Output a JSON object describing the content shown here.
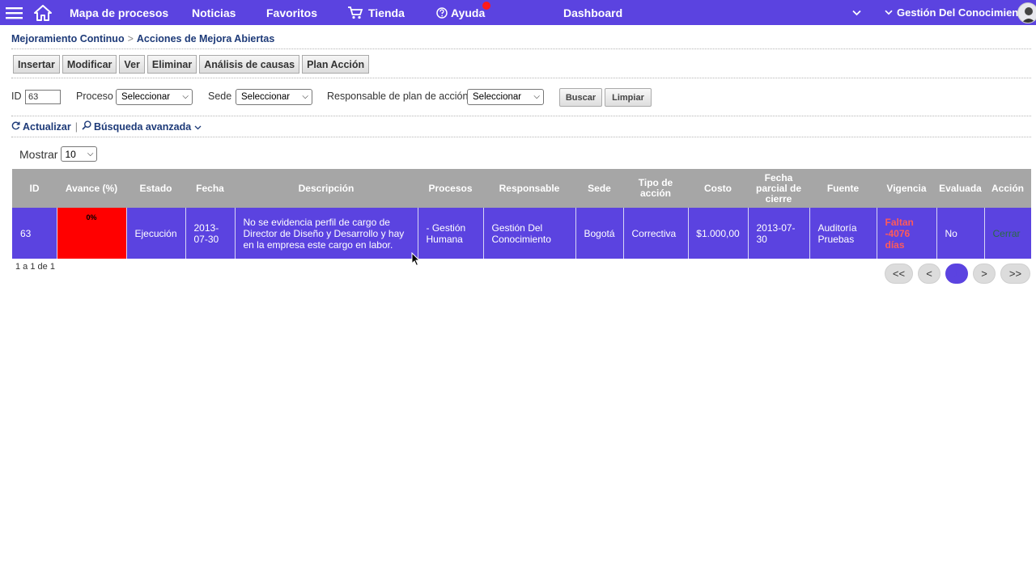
{
  "nav": {
    "items": [
      "Mapa de procesos",
      "Noticias",
      "Favoritos",
      "Tienda",
      "Ayuda",
      "Dashboard"
    ],
    "user": "Gestión Del Conocimiento"
  },
  "breadcrumb": [
    "Mejoramiento Continuo",
    "Acciones de Mejora Abiertas"
  ],
  "toolbar": [
    "Insertar",
    "Modificar",
    "Ver",
    "Eliminar",
    "Análisis de causas",
    "Plan Acción"
  ],
  "filters": {
    "id_label": "ID",
    "id_value": "63",
    "proceso_label": "Proceso",
    "proceso_value": "Seleccionar",
    "sede_label": "Sede",
    "sede_value": "Seleccionar",
    "responsable_label": "Responsable de plan de acción",
    "responsable_value": "Seleccionar",
    "buscar": "Buscar",
    "limpiar": "Limpiar"
  },
  "links": {
    "actualizar": "Actualizar",
    "busqueda": "Búsqueda avanzada"
  },
  "mostrar": {
    "label": "Mostrar",
    "value": "10"
  },
  "table": {
    "headers": [
      "ID",
      "Avance (%)",
      "Estado",
      "Fecha",
      "Descripción",
      "Procesos",
      "Responsable",
      "Sede",
      "Tipo de acción",
      "Costo",
      "Fecha parcial de cierre",
      "Fuente",
      "Vigencia",
      "Evaluada",
      "Acción"
    ],
    "rows": [
      [
        "63",
        "0%",
        "Ejecución",
        "2013-07-30",
        "No se evidencia perfil de cargo de Director de Diseño y Desarrollo y hay en la empresa este cargo en labor.",
        "- Gestión Humana",
        "Gestión Del Conocimiento",
        "Bogotá",
        "Correctiva",
        "$1.000,00",
        "2013-07-30",
        "Auditoría Pruebas",
        "Faltan -4076 días",
        "No",
        "Cerrar"
      ]
    ]
  },
  "pager": {
    "info": "1 a 1 de 1",
    "buttons": [
      "<<",
      "<",
      "1",
      ">",
      ">>"
    ]
  }
}
